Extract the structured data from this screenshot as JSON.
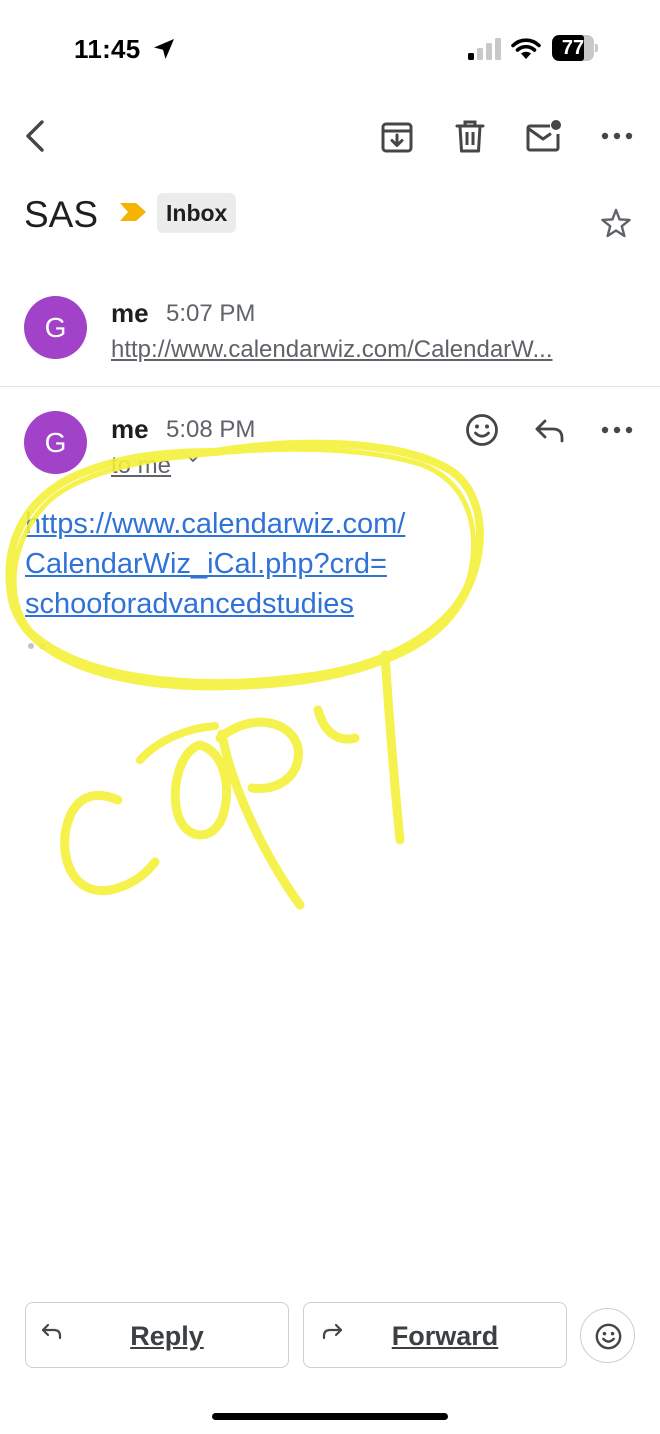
{
  "status_bar": {
    "time": "11:45",
    "battery_level": "77",
    "icons": [
      "location-arrow-icon",
      "cellular-signal-icon",
      "wifi-icon",
      "battery-icon"
    ]
  },
  "toolbar": {
    "icons": [
      "back-icon",
      "archive-icon",
      "delete-icon",
      "mark-unread-icon",
      "more-icon"
    ]
  },
  "thread": {
    "subject": "SAS",
    "label": "Inbox",
    "importance_color": "#f4b400",
    "star_icon": "star-outline-icon"
  },
  "messages": [
    {
      "avatar_letter": "G",
      "avatar_color": "#a142c8",
      "sender": "me",
      "time": "5:07 PM",
      "snippet": "http://www.calendarwiz.com/CalendarW..."
    },
    {
      "avatar_letter": "G",
      "avatar_color": "#a142c8",
      "sender": "me",
      "time": "5:08 PM",
      "recipient": "to me",
      "body_link_lines": [
        "https://www.calendarwiz.com/",
        "CalendarWiz_iCal.php?crd=",
        "schooforadvancedstudies"
      ],
      "link_color": "#2f72d8"
    }
  ],
  "annotation": {
    "handwritten_text": "COPY",
    "color": "#f5f03a"
  },
  "actions": {
    "reply_label": "Reply",
    "forward_label": "Forward",
    "emoji_icon": "emoji-react-icon"
  }
}
